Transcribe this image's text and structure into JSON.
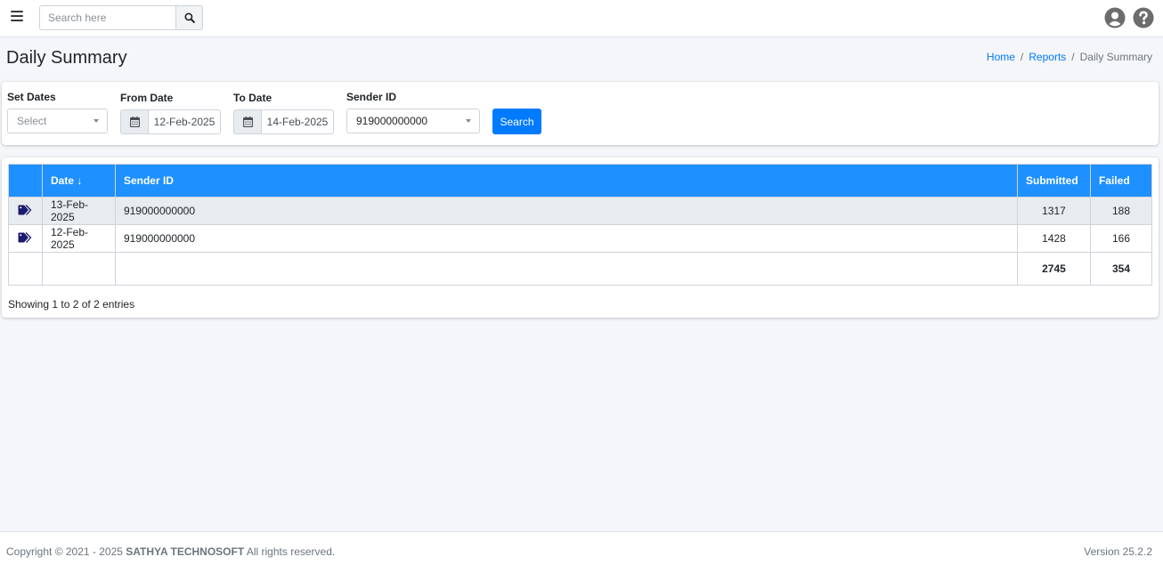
{
  "navbar": {
    "menu_icon": "hamburger-icon",
    "search_placeholder": "Search here",
    "search_icon": "search-icon",
    "user_icon": "user-circle-icon",
    "help_icon": "question-circle-icon"
  },
  "page": {
    "title": "Daily Summary",
    "breadcrumb": [
      {
        "label": "Home",
        "link": true
      },
      {
        "label": "Reports",
        "link": true
      },
      {
        "label": "Daily Summary",
        "link": false
      }
    ],
    "breadcrumb_separator": "/"
  },
  "filters": {
    "set_dates": {
      "label": "Set Dates",
      "value": "Select"
    },
    "from_date": {
      "label": "From Date",
      "value": "12-Feb-2025",
      "icon": "calendar-icon"
    },
    "to_date": {
      "label": "To Date",
      "value": "14-Feb-2025",
      "icon": "calendar-icon"
    },
    "sender_id": {
      "label": "Sender ID",
      "value": "919000000000"
    },
    "search_button": "Search"
  },
  "table": {
    "columns": [
      "",
      "Date",
      "Sender ID",
      "Submitted",
      "Failed"
    ],
    "sort_indicator": "↓",
    "rows": [
      {
        "icon": "tags-icon",
        "date": "13-Feb-2025",
        "sender_id": "919000000000",
        "submitted": "1317",
        "failed": "188"
      },
      {
        "icon": "tags-icon",
        "date": "12-Feb-2025",
        "sender_id": "919000000000",
        "submitted": "1428",
        "failed": "166"
      }
    ],
    "totals": {
      "submitted": "2745",
      "failed": "354"
    },
    "info": "Showing 1 to 2 of 2 entries"
  },
  "footer": {
    "copyright_prefix": "Copyright © 2021 - 2025 ",
    "company": "SATHYA TECHNOSOFT",
    "copyright_suffix": " All rights reserved.",
    "version": "Version 25.2.2"
  },
  "colors": {
    "primary": "#007bff",
    "table_header": "#1e90ff",
    "tag_icon": "#1a1a6e"
  }
}
